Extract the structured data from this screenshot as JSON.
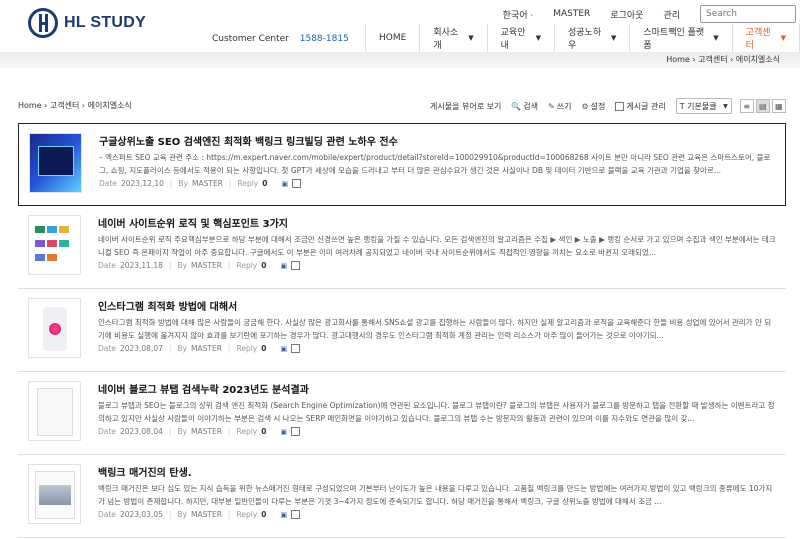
{
  "header": {
    "logo_text": "HL STUDY",
    "top_links": [
      "한국어 ·",
      "MASTER",
      "로그아웃",
      "관리"
    ],
    "search_placeholder": "Search",
    "customer_center_label": "Customer Center",
    "customer_center_phone": "1588-1815",
    "nav": [
      {
        "label": "HOME",
        "has_caret": false,
        "active": false
      },
      {
        "label": "회사소개",
        "has_caret": true,
        "active": false
      },
      {
        "label": "교육안내",
        "has_caret": true,
        "active": false
      },
      {
        "label": "성공노하우",
        "has_caret": true,
        "active": false
      },
      {
        "label": "스마트짹인 플랫폼",
        "has_caret": true,
        "active": false
      },
      {
        "label": "고객센터",
        "has_caret": true,
        "active": true
      }
    ],
    "breadcrumb_top": "Home › 고객센터 › 에이치엘소식",
    "accent_color": "#e8562a",
    "brand_color": "#1e3a6e"
  },
  "board": {
    "breadcrumb": "Home › 고객센터 › 에이치엘소식",
    "toolbar": {
      "view_posts": "게시물을 뷰어로 보기",
      "search": "검색",
      "write": "쓰기",
      "settings": "설정",
      "board_admin": "게시글 관리",
      "sort_selected": "기본물클",
      "sort_prefix": "T"
    },
    "posts": [
      {
        "title": "구글상위노출 SEO 검색엔진 최적화 백링크 링크빌딩 관련 노하우 전수",
        "excerpt": "– 엑스퍼트 SEO 교육 관련 주소 : https://m.expert.naver.com/mobile/expert/product/detail?storeId=100029910&productId=100068268 사이트 분만 아니라 SEO 관련 교육은 스마트스토어, 블로그, 쇼핑, 지도플러이스 등에서도 적용이 되는 사항입니다. 첫 GPT가 세상에 모습을 드러내고 부터 더 많은 관심수요가 생긴 것은 사실이나 DB 및 데이터 기반으로 블랙을 교육 기관과 기업을 찾아르...",
        "date": "2023,12,10",
        "author": "MASTER",
        "reply": "0",
        "selected": true
      },
      {
        "title": "네이버 사이트순위 로직 및 핵심포인트 3가지",
        "excerpt": "네이버 사이트순위 로직 주요핵심부분으로 하당 부분에 대해서 조금만 신경쓰면 높은 랭킹을 가질 수 있습니다. 모든 검색엔진의 알고리즘은 수집 ▶ 색인 ▶ 노출 ▶ 랭킹 순서로 가고 있으며 수집과 색인 부분에서는 테크니컬 SEO 즉 온페이지 작업이 아주 중요합니다. 구글에서도 이 부분은 이미 여러차례 공지되었고 네이버 국내 사이트순위에서도 직접적인 영향을 끼치는 요소로 바뀐지 오래되었...",
        "date": "2023,11,18",
        "author": "MASTER",
        "reply": "0",
        "selected": false
      },
      {
        "title": "인스타그램 최적화 방법에 대해서",
        "excerpt": "인스타그램 최적화 방법에 대해 많은 사람들이 궁금해 한다. 사실상 많은 광고회사를 통해서 SNS쇼셜 광고를 집행하는 사람들이 많다. 하지만 실제 알고리즘과 로직을 교육해준다 한들 비용 성업에 있어서 관리가 안 되기에 비용도 실행에 옮겨지지 않아 효과를 보기란에 포기하는 경우가 많다. 광고대행사의 경우도 인스타그램 최적화 계정 관리는 인력 리소스가 아주 많이 들어가는 것으로 이야기되...",
        "date": "2023,08,07",
        "author": "MASTER",
        "reply": "0",
        "selected": false
      },
      {
        "title": "네이버 블로그 뷰탭 검색누락 2023년도 분석결과",
        "excerpt": "블로그 뷰탭과 SEO는 블로그의 상위 검색 엔진 최적화 (Search Engine Optimization)에 연관된 요소입니다. 블로그 뷰탭이란? 블로그의 뷰탭은 사용자가 블로그를 방문하고 탭을 전환할 때 발생하는 이벤트라고 정의하고 있지만 사실상 사람들이 이야기하는 부분은 검색 시 나오는 SERP 메인화면을 이야기하고 있습니다. 블로그의 뷰탭 수는 방문자의 활동과 관련이 있으며 이를 지수와도 연관을 많이 갖...",
        "date": "2023,08,04",
        "author": "MASTER",
        "reply": "0",
        "selected": false
      },
      {
        "title": "백링크 매거진의 탄생.",
        "excerpt": "백링크 매거진은 보다 심도 있는 지식 습득을 위한 뉴스매거진 형태로 구성되었으며 기본부터 난이도가 높은 내용을 다루고 있습니다. 고품질 백링크를 만드는 방법에는 여러가지 방법이 있고 백링크의 종류에도 10가지가 넘는 방법이 존재합니다. 하지만, 대부분 일반인들이 다루는 부분은 기껏 3~4가지 정도에 준속되기도 합니다. 허당 매거진을 통해서 백링크, 구글 상위노출 방법에 대해서 조금 ...",
        "date": "2023,03,05",
        "author": "MASTER",
        "reply": "0",
        "selected": false
      }
    ],
    "meta_labels": {
      "date": "Date",
      "by": "By",
      "reply": "Reply"
    }
  }
}
